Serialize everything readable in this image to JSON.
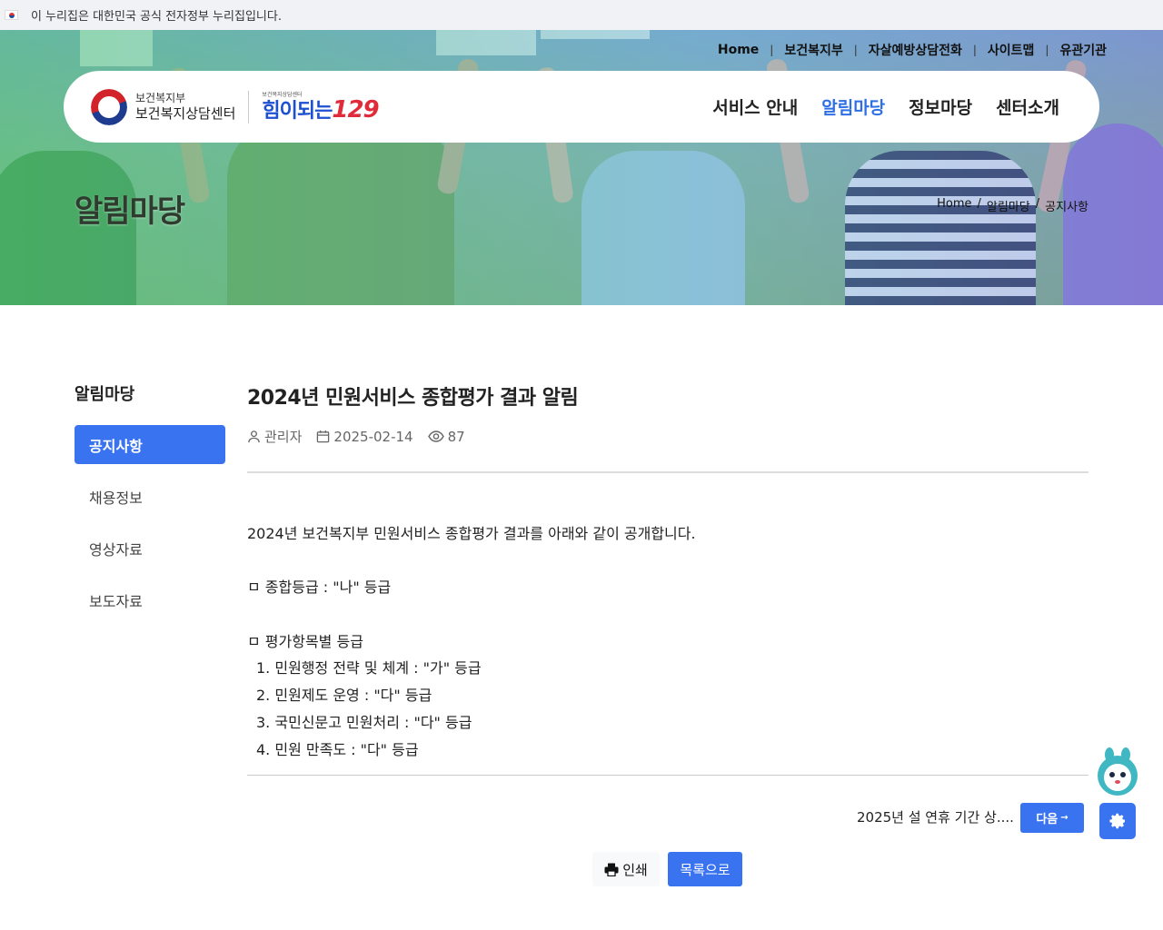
{
  "gov_banner": {
    "text": "이 누리집은 대한민국 공식 전자정부 누리집입니다."
  },
  "util_nav": [
    "Home",
    "보건복지부",
    "자살예방상담전화",
    "사이트맵",
    "유관기관"
  ],
  "brand": {
    "ministry": "보건복지부",
    "center": "보건복지상담센터",
    "logo_tiny": "보건복지상담센터",
    "logo_text": "힘이되는",
    "logo_number": "129"
  },
  "main_menu": [
    "서비스 안내",
    "알림마당",
    "정보마당",
    "센터소개"
  ],
  "hero": {
    "title": "알림마당"
  },
  "breadcrumb": [
    "Home",
    "알림마당",
    "공지사항"
  ],
  "sidebar": {
    "title": "알림마당",
    "items": [
      "공지사항",
      "채용정보",
      "영상자료",
      "보도자료"
    ]
  },
  "article": {
    "title": "2024년 민원서비스 종합평가 결과 알림",
    "author": "관리자",
    "date": "2025-02-14",
    "views": "87",
    "lines": [
      "2024년 보건복지부 민원서비스 종합평가 결과를 아래와 같이 공개합니다.",
      "",
      "ㅁ 종합등급 : \"나\" 등급",
      "",
      "ㅁ 평가항목별 등급",
      "1. 민원행정 전략 및 체계 : \"가\" 등급",
      "2. 민원제도 운영 : \"다\" 등급",
      "3. 국민신문고 민원처리 : \"다\" 등급",
      "4. 민원 만족도 : \"다\" 등급"
    ]
  },
  "next_post": {
    "title": "2025년 설 연휴 기간 상....",
    "button": "다음"
  },
  "actions": {
    "print": "인쇄",
    "list": "목록으로"
  },
  "colors": {
    "primary": "#3a73f0",
    "accent_red": "#e02b3a"
  }
}
